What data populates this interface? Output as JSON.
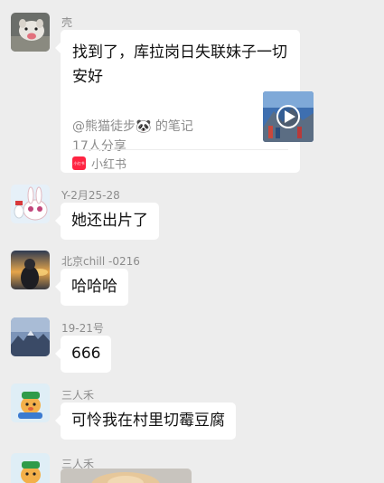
{
  "messages": [
    {
      "sender": "壳",
      "card": {
        "title": "找到了，库拉岗日失联妹子一切安好",
        "author": "@熊猫徒步🐼 的笔记",
        "shares": "17人分享",
        "app_name": "小红书",
        "app_logo_text": "小红书",
        "thumb_icon": "play-icon"
      }
    },
    {
      "sender": "Y-2月25-28",
      "text": "她还出片了"
    },
    {
      "sender": "北京chill -0216",
      "text": "哈哈哈"
    },
    {
      "sender": "19-21号",
      "text": "666"
    },
    {
      "sender": "三人禾",
      "text": "可怜我在村里切霉豆腐"
    },
    {
      "sender": "三人禾"
    }
  ],
  "colors": {
    "background": "#ededed",
    "bubble": "#ffffff",
    "brand": "#ff2442",
    "muted": "#8c8c8c"
  }
}
